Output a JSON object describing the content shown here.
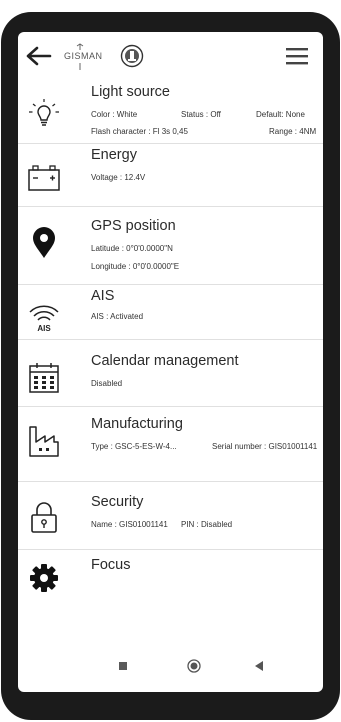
{
  "app": {
    "logo_text": "GISMAN"
  },
  "sections": {
    "light": {
      "title": "Light source",
      "color": "Color : White",
      "status": "Status : Off",
      "default": "Default:  None",
      "flash": "Flash character : Fl 3s 0,45",
      "range": "Range : 4NM"
    },
    "energy": {
      "title": "Energy",
      "voltage": "Voltage : 12.4V"
    },
    "gps": {
      "title": "GPS position",
      "latitude": "Latitude : 0°0'0.0000\"N",
      "longitude": "Longitude : 0°0'0.0000\"E"
    },
    "ais": {
      "title": "AIS",
      "status": "AIS : Activated",
      "icon_label": "AIS"
    },
    "calendar": {
      "title": "Calendar management",
      "status": "Disabled"
    },
    "manufacturing": {
      "title": "Manufacturing",
      "type": "Type : GSC-5-ES-W-4...",
      "serial": "Serial number : GIS01001141"
    },
    "security": {
      "title": "Security",
      "name": "Name : GIS01001141",
      "pin": "PIN : Disabled"
    },
    "focus": {
      "title": "Focus"
    }
  },
  "icons": {
    "back": "arrow-left-icon",
    "menu": "hamburger-menu-icon",
    "light": "lightbulb-icon",
    "energy": "battery-icon",
    "gps": "map-pin-icon",
    "ais": "wireless-signal-icon",
    "calendar": "calendar-icon",
    "manufacturing": "factory-icon",
    "security": "padlock-icon",
    "focus": "gear-icon"
  }
}
